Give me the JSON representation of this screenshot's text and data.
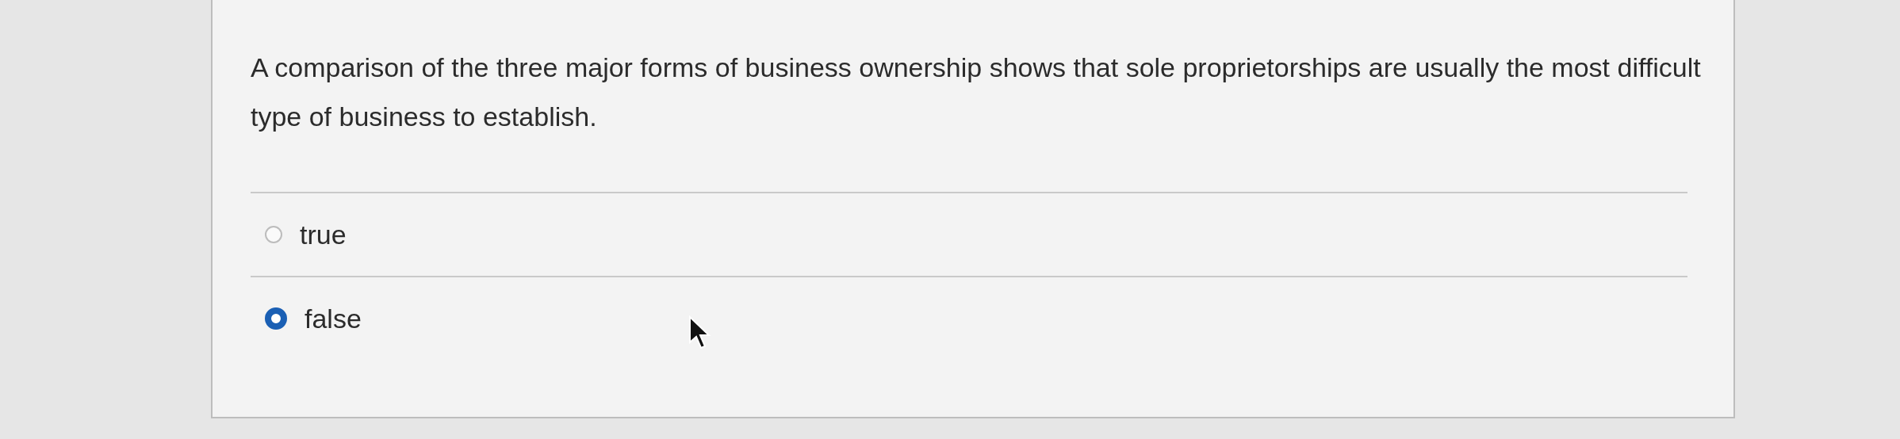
{
  "question": {
    "text": "A comparison of the three major forms of business ownership shows that sole proprietorships are usually the most difficult type of business to establish."
  },
  "options": [
    {
      "label": "true",
      "selected": false
    },
    {
      "label": "false",
      "selected": true
    }
  ]
}
